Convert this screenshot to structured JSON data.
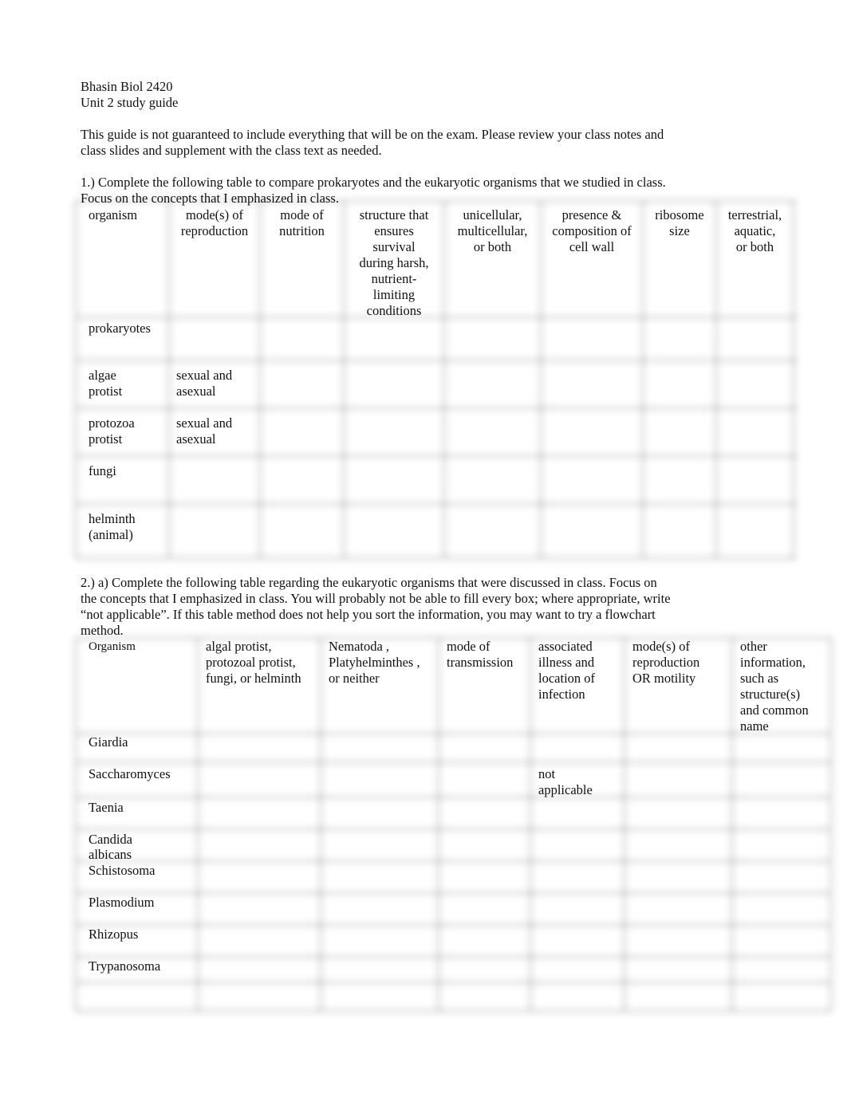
{
  "header": {
    "course": "Bhasin Biol 2420",
    "title": "Unit 2 study guide"
  },
  "intro": [
    "This guide is not guaranteed to include everything that will be on the exam. Please review your class notes and",
    "class slides and supplement with the class text as needed."
  ],
  "question1": {
    "prompt": [
      "1.) Complete the following table to compare prokaryotes and the eukaryotic organisms that we studied in class.",
      "Focus on the concepts that I emphasized in class."
    ],
    "columns": [
      [
        "organism"
      ],
      [
        "mode(s) of",
        "reproduction"
      ],
      [
        "mode of",
        "nutrition"
      ],
      [
        "structure that",
        "ensures",
        "survival",
        "during harsh,",
        "nutrient-",
        "limiting",
        "conditions"
      ],
      [
        "unicellular,",
        "multicellular,",
        "or both"
      ],
      [
        "presence &",
        "composition of",
        "cell wall"
      ],
      [
        "ribosome",
        "size"
      ],
      [
        "terrestrial,",
        "aquatic,",
        "or both"
      ]
    ],
    "rows": [
      {
        "organism": [
          "prokaryotes"
        ],
        "reproduction": []
      },
      {
        "organism": [
          "algae",
          "protist"
        ],
        "reproduction": [
          "sexual and",
          "asexual"
        ]
      },
      {
        "organism": [
          "protozoa",
          "protist"
        ],
        "reproduction": [
          "sexual and",
          "asexual"
        ]
      },
      {
        "organism": [
          "fungi"
        ],
        "reproduction": []
      },
      {
        "organism": [
          "helminth",
          "(animal)"
        ],
        "reproduction": []
      }
    ]
  },
  "question2": {
    "prompt": [
      "2.) a) Complete the following table regarding the eukaryotic organisms that were discussed in class. Focus on",
      "the concepts that I emphasized in class. You will probably not be able to fill every box; where appropriate, write",
      "“not applicable”. If this table method does not help you sort the information, you may want to try a flowchart",
      "method."
    ],
    "columns": [
      [
        "Organism"
      ],
      [
        "algal protist,",
        "protozoal protist,",
        "fungi, or helminth"
      ],
      [
        "Nematoda  ,",
        "Platyhelminthes   ,",
        "or neither"
      ],
      [
        "mode of",
        "transmission"
      ],
      [
        "associated",
        "illness and",
        "location of",
        "infection"
      ],
      [
        "mode(s) of",
        "reproduction",
        "OR motility"
      ],
      [
        "other",
        "information,",
        "such as",
        "structure(s)",
        "and common",
        "name"
      ]
    ],
    "rows": [
      {
        "organism": [
          "Giardia"
        ],
        "illness": []
      },
      {
        "organism": [
          "Saccharomyces"
        ],
        "illness": [
          "not",
          "applicable"
        ]
      },
      {
        "organism": [
          "Taenia"
        ],
        "illness": []
      },
      {
        "organism": [
          "Candida",
          "albicans"
        ],
        "illness": []
      },
      {
        "organism": [
          "Schistosoma"
        ],
        "illness": []
      },
      {
        "organism": [
          "Plasmodium"
        ],
        "illness": []
      },
      {
        "organism": [
          "Rhizopus"
        ],
        "illness": []
      },
      {
        "organism": [
          "Trypanosoma"
        ],
        "illness": []
      },
      {
        "organism": [],
        "illness": []
      }
    ]
  }
}
